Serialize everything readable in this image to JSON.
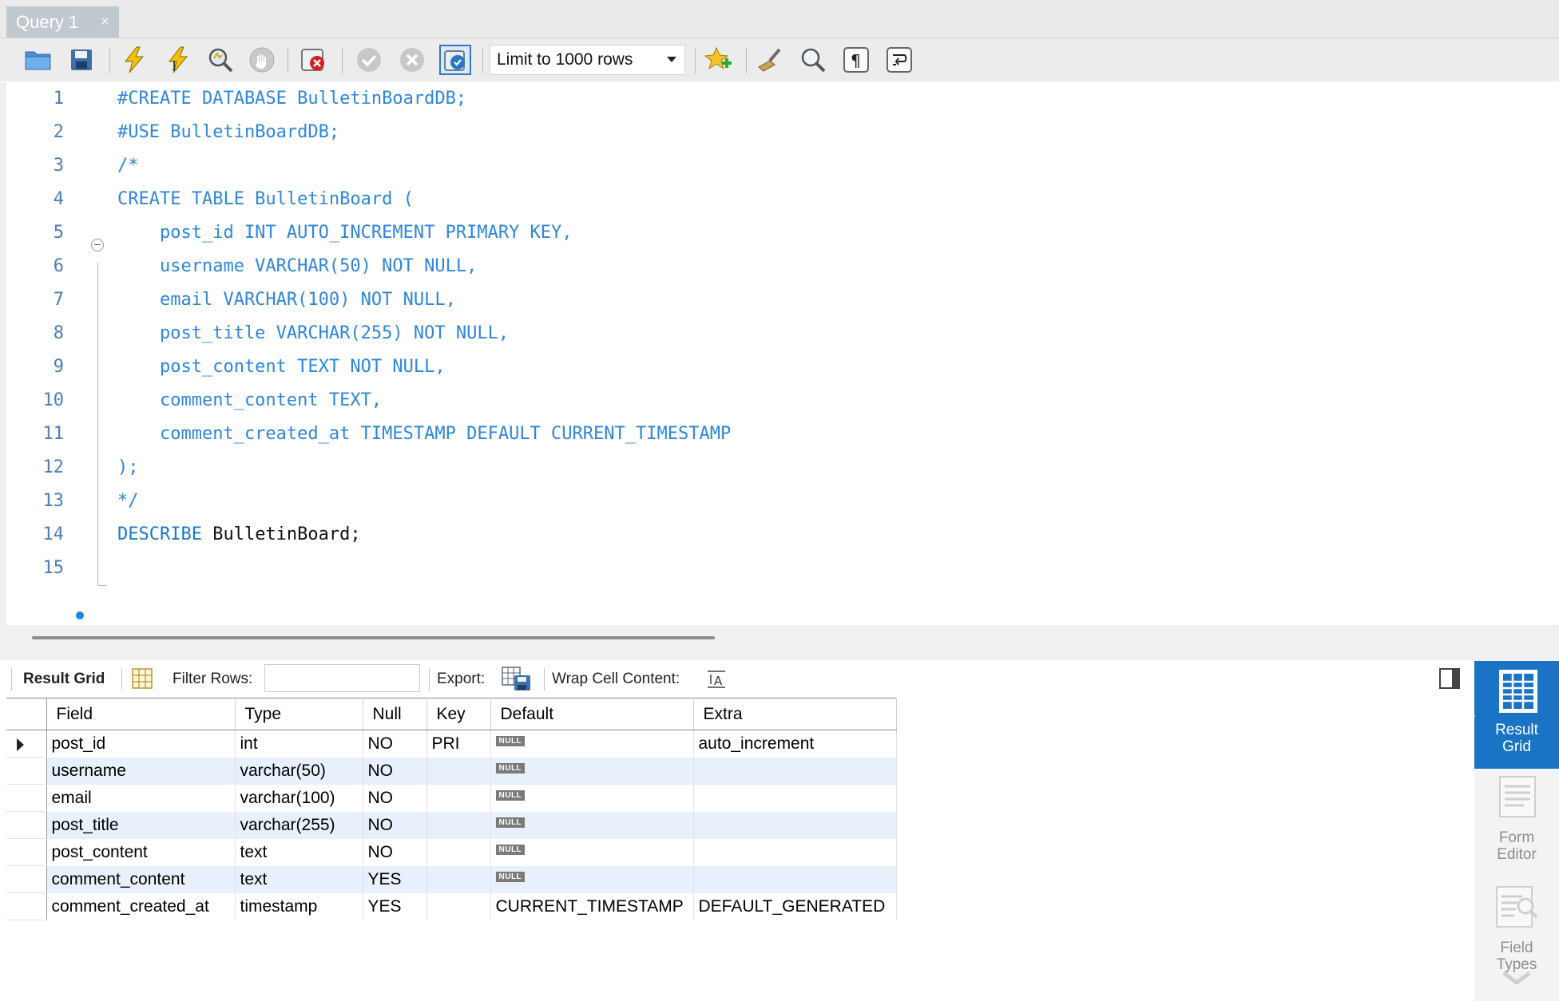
{
  "tab": {
    "title": "Query 1",
    "close": "×"
  },
  "toolbar": {
    "limit_select": "Limit to 1000 rows",
    "icons": [
      "open-folder-icon",
      "save-icon",
      "execute-icon",
      "execute-current-icon",
      "explain-icon",
      "stop-icon",
      "toggle-error-icon",
      "commit-icon",
      "rollback-icon",
      "autocommit-icon",
      "add-snippet-icon",
      "beautify-icon",
      "find-icon",
      "invisible-chars-icon",
      "word-wrap-icon"
    ]
  },
  "editor": {
    "lines": [
      {
        "n": "1",
        "segments": [
          {
            "text": "#CREATE DATABASE BulletinBoardDB;",
            "cls": "c-comment"
          }
        ]
      },
      {
        "n": "2",
        "segments": [
          {
            "text": "#USE BulletinBoardDB;",
            "cls": "c-comment"
          }
        ]
      },
      {
        "n": "3",
        "segments": [
          {
            "text": "/*",
            "cls": "c-comment"
          }
        ]
      },
      {
        "n": "4",
        "segments": [
          {
            "text": "CREATE TABLE BulletinBoard (",
            "cls": "c-comment"
          }
        ]
      },
      {
        "n": "5",
        "segments": [
          {
            "text": "    post_id INT AUTO_INCREMENT PRIMARY KEY,",
            "cls": "c-comment"
          }
        ]
      },
      {
        "n": "6",
        "segments": [
          {
            "text": "    username VARCHAR(50) NOT NULL,",
            "cls": "c-comment"
          }
        ]
      },
      {
        "n": "7",
        "segments": [
          {
            "text": "    email VARCHAR(100) NOT NULL,",
            "cls": "c-comment"
          }
        ]
      },
      {
        "n": "8",
        "segments": [
          {
            "text": "    post_title VARCHAR(255) NOT NULL,",
            "cls": "c-comment"
          }
        ]
      },
      {
        "n": "9",
        "segments": [
          {
            "text": "    post_content TEXT NOT NULL,",
            "cls": "c-comment"
          }
        ]
      },
      {
        "n": "10",
        "segments": [
          {
            "text": "    comment_content TEXT,",
            "cls": "c-comment"
          }
        ]
      },
      {
        "n": "11",
        "segments": [
          {
            "text": "    comment_created_at TIMESTAMP DEFAULT CURRENT_TIMESTAMP",
            "cls": "c-comment"
          }
        ]
      },
      {
        "n": "12",
        "segments": [
          {
            "text": ");",
            "cls": "c-comment"
          }
        ]
      },
      {
        "n": "13",
        "segments": [
          {
            "text": "*/",
            "cls": "c-comment"
          }
        ]
      },
      {
        "n": "14",
        "segments": [
          {
            "text": "DESCRIBE",
            "cls": "kw"
          },
          {
            "text": " BulletinBoard;",
            "cls": "plain"
          }
        ]
      },
      {
        "n": "15",
        "segments": [
          {
            "text": "",
            "cls": "plain"
          }
        ]
      }
    ]
  },
  "result_toolbar": {
    "result_grid": "Result Grid",
    "filter_rows": "Filter Rows:",
    "filter_value": "",
    "export": "Export:",
    "wrap_cell": "Wrap Cell Content:"
  },
  "grid": {
    "columns": [
      "Field",
      "Type",
      "Null",
      "Key",
      "Default",
      "Extra"
    ],
    "rows": [
      [
        "post_id",
        "int",
        "NO",
        "PRI",
        "NULL",
        "auto_increment"
      ],
      [
        "username",
        "varchar(50)",
        "NO",
        "",
        "NULL",
        ""
      ],
      [
        "email",
        "varchar(100)",
        "NO",
        "",
        "NULL",
        ""
      ],
      [
        "post_title",
        "varchar(255)",
        "NO",
        "",
        "NULL",
        ""
      ],
      [
        "post_content",
        "text",
        "NO",
        "",
        "NULL",
        ""
      ],
      [
        "comment_content",
        "text",
        "YES",
        "",
        "NULL",
        ""
      ],
      [
        "comment_created_at",
        "timestamp",
        "YES",
        "",
        "CURRENT_TIMESTAMP",
        "DEFAULT_GENERATED"
      ]
    ]
  },
  "side_panel": {
    "result_grid": [
      "Result",
      "Grid"
    ],
    "form_editor": [
      "Form",
      "Editor"
    ],
    "field_types": [
      "Field",
      "Types"
    ]
  },
  "colors": {
    "comment": "#2e86de",
    "keyword": "#1a7ac8",
    "side_active": "#1b73c5",
    "row_alt": "#e8f0fb"
  }
}
